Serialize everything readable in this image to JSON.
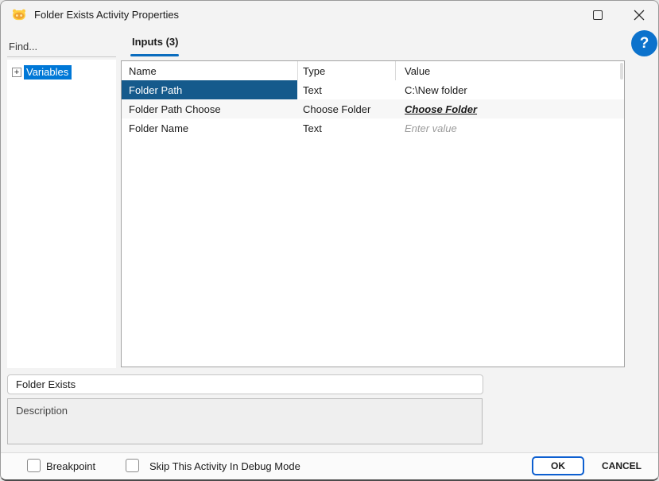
{
  "window": {
    "title": "Folder Exists Activity Properties",
    "icons": {
      "app": "robot",
      "maximize": "maximize",
      "close": "close"
    }
  },
  "help": {
    "glyph": "?"
  },
  "sidebar": {
    "find_placeholder": "Find...",
    "tree": {
      "expander_glyph": "+",
      "root_label": "Variables"
    }
  },
  "main": {
    "tab_label": "Inputs (3)",
    "table": {
      "columns": [
        "Name",
        "Type",
        "Value"
      ],
      "rows": [
        {
          "name": "Folder Path",
          "type": "Text",
          "value": "C:\\New folder"
        },
        {
          "name": "Folder Path Choose",
          "type": "Choose Folder",
          "value": "Choose Folder"
        },
        {
          "name": "Folder Name",
          "type": "Text",
          "value": "Enter value"
        }
      ]
    }
  },
  "activity": {
    "name_value": "Folder Exists",
    "description_placeholder": "Description"
  },
  "footer": {
    "breakpoint_label": "Breakpoint",
    "skip_label": "Skip This Activity In Debug Mode",
    "ok_label": "OK",
    "cancel_label": "CANCEL"
  },
  "colors": {
    "dialog_bg": "#f3f3f3",
    "selected_cell_bg": "#155a8c",
    "tree_selection_bg": "#0078d7",
    "tab_underline": "#0a6cbe",
    "help_bg": "#0c72cc",
    "ok_border": "#0d5fd0"
  }
}
